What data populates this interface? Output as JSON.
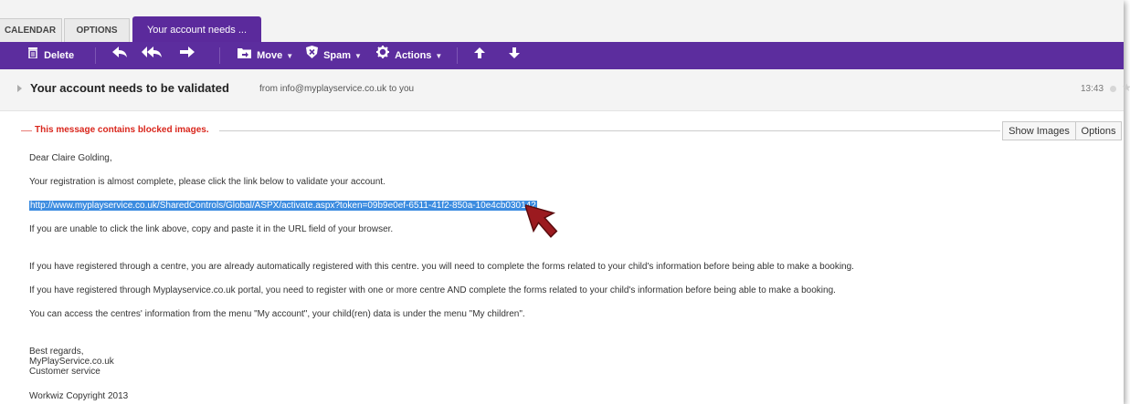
{
  "tabs": [
    {
      "label": "CALENDAR"
    },
    {
      "label": "OPTIONS"
    },
    {
      "label": "Your account needs ..."
    }
  ],
  "toolbar": {
    "delete": "Delete",
    "move": "Move",
    "spam": "Spam",
    "actions": "Actions",
    "accent": "#5c2d9e"
  },
  "message": {
    "subject": "Your account needs to be validated",
    "from_line": "from info@myplayservice.co.uk to you",
    "time": "13:43",
    "blocked_notice": "This message contains blocked images.",
    "show_images": "Show Images",
    "options": "Options",
    "body": {
      "greeting": "Dear Claire Golding,",
      "line1": "Your registration is almost complete, please click the link below to validate your account.",
      "link": "http://www.myplayservice.co.uk/SharedControls/Global/ASPX/activate.aspx?token=09b9e0ef-6511-41f2-850a-10e4cb030142",
      "line2": "If you are unable to click the link above, copy and paste it in the URL field of your browser.",
      "line3": "If you have registered through a centre, you are already automatically registered with this centre. you will need to complete the forms related to your child's information before being able to make a booking.",
      "line4": "If you have registered through Myplayservice.co.uk portal, you need to register with one or more centre AND complete the forms related to your child's information before being able to make a booking.",
      "line5": "You can access the centres' information from the menu  \"My account\", your child(ren) data is under the menu \"My children\".",
      "sign1": "Best regards,",
      "sign2": "MyPlayService.co.uk",
      "sign3": "Customer service",
      "footer": "Workwiz Copyright 2013"
    }
  }
}
